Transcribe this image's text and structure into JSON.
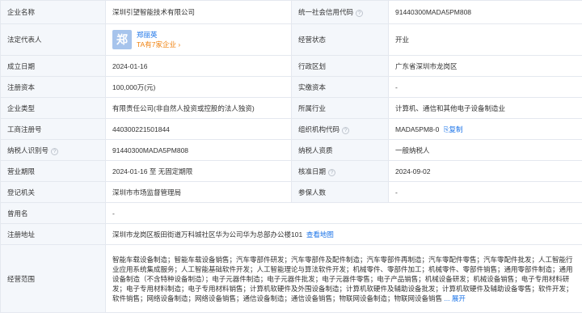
{
  "rows": [
    {
      "l1": "企业名称",
      "v1": "深圳引望智能技术有限公司",
      "l2": "统一社会信用代码",
      "v2": "91440300MADA5PM808"
    },
    {
      "l1": "法定代表人",
      "legal_name": "郑丽英",
      "legal_sub": "TA有7家企业 ›",
      "avatar": "郑",
      "l2": "经营状态",
      "v2": "开业"
    },
    {
      "l1": "成立日期",
      "v1": "2024-01-16",
      "l2": "行政区划",
      "v2": "广东省深圳市龙岗区"
    },
    {
      "l1": "注册资本",
      "v1": "100,000万(元)",
      "l2": "实缴资本",
      "v2": "-"
    },
    {
      "l1": "企业类型",
      "v1": "有限责任公司(非自然人投资或控股的法人独资)",
      "l2": "所属行业",
      "v2": "计算机、通信和其他电子设备制造业"
    },
    {
      "l1": "工商注册号",
      "v1": "440300221501844",
      "l2": "组织机构代码",
      "v2": "MADA5PM8-0",
      "copy": "复制"
    },
    {
      "l1": "纳税人识别号",
      "v1": "91440300MADA5PM808",
      "l2": "纳税人资质",
      "v2": "一般纳税人"
    },
    {
      "l1": "营业期限",
      "v1": "2024-01-16 至 无固定期限",
      "l2": "核准日期",
      "v2": "2024-09-02"
    },
    {
      "l1": "登记机关",
      "v1": "深圳市市场监督管理局",
      "l2": "参保人数",
      "v2": "-"
    },
    {
      "l1": "曾用名",
      "v1": "-"
    },
    {
      "l1": "注册地址",
      "v1": "深圳市龙岗区板田街道万科城社区华为公司华为总部办公楼101",
      "link": "查看地图"
    },
    {
      "l1": "经营范围",
      "v1": "智能车载设备制造；智能车载设备销售；汽车零部件研发；汽车零部件及配件制造；汽车零部件再制造；汽车零配件零售；汽车零配件批发；人工智能行业应用系统集成服务；人工智能基础软件开发；人工智能理论与算法软件开发；机械零件、零部件加工；机械零件、零部件销售；通用零部件制造；通用设备制造（不含特种设备制造）；电子元器件制造；电子元器件批发；电子元器件零售；电子产品销售；机械设备研发；机械设备销售；电子专用材料研发；电子专用材料制造；电子专用材料销售；计算机软硬件及外围设备制造；计算机软硬件及辅助设备批发；计算机软硬件及辅助设备零售；软件开发；软件销售；网络设备制造；网络设备销售；通信设备制造；通信设备销售；物联网设备制造；物联网设备销售",
      "more": "... 展开"
    }
  ]
}
